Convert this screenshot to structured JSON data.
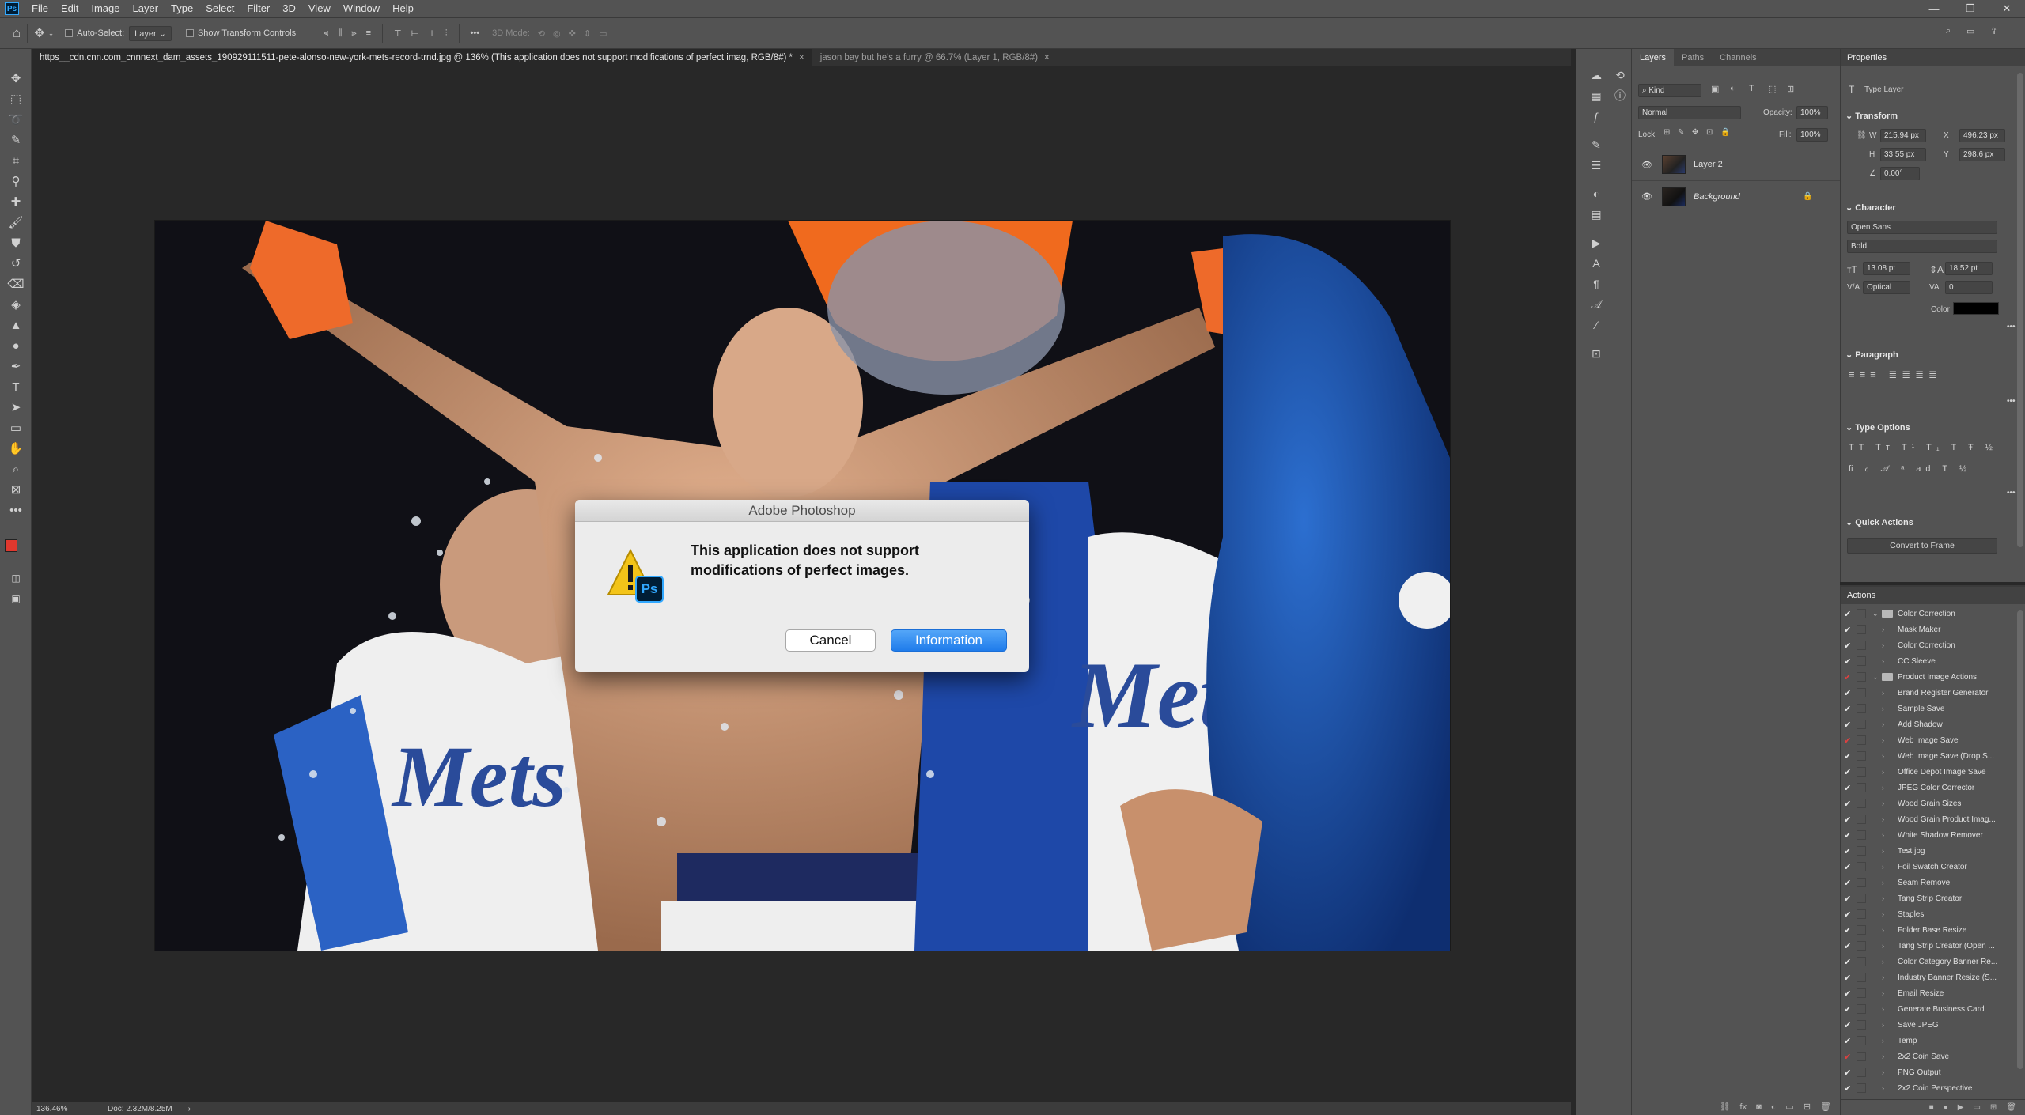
{
  "menubar": {
    "items": [
      "File",
      "Edit",
      "Image",
      "Layer",
      "Type",
      "Select",
      "Filter",
      "3D",
      "View",
      "Window",
      "Help"
    ],
    "ps_logo": "Ps",
    "window_controls": [
      "—",
      "❐",
      "✕"
    ]
  },
  "options": {
    "auto_select_label": "Auto-Select:",
    "auto_select_value": "Layer",
    "transform_label": "Show Transform Controls",
    "mode3d_label": "3D Mode:"
  },
  "tabs": [
    {
      "label": "https__cdn.cnn.com_cnnnext_dam_assets_190929111511-pete-alonso-new-york-mets-record-trnd.jpg @ 136% (This application does not support modifications of perfect imag, RGB/8#) *",
      "close": "×"
    },
    {
      "label": "jason bay but he's a furry @ 66.7% (Layer 1, RGB/8#)",
      "close": "×"
    }
  ],
  "status": {
    "zoom": "136.46%",
    "doc": "Doc: 2.32M/8.25M",
    "arrow": "›"
  },
  "dialog": {
    "title": "Adobe Photoshop",
    "message": "This application does not support modifications of perfect images.",
    "cancel": "Cancel",
    "info": "Information",
    "ps_badge": "Ps"
  },
  "layers_panel": {
    "tabs": [
      "Layers",
      "Paths",
      "Channels"
    ],
    "kind": "Kind",
    "blend": "Normal",
    "opacity_label": "Opacity:",
    "opacity": "100%",
    "lock_label": "Lock:",
    "fill_label": "Fill:",
    "fill": "100%",
    "layers": [
      {
        "name": "Layer 2"
      },
      {
        "name": "Background"
      }
    ]
  },
  "properties": {
    "title": "Properties",
    "type_label": "Type Layer",
    "transform": "Transform",
    "w": "215.94 px",
    "h": "33.55 px",
    "x": "496.23 px",
    "y": "298.6 px",
    "angle": "0.00°",
    "character": "Character",
    "font": "Open Sans",
    "style": "Bold",
    "size": "13.08 pt",
    "leading": "18.52 pt",
    "kerning": "Optical",
    "tracking": "0",
    "color_label": "Color",
    "paragraph": "Paragraph",
    "type_options": "Type Options",
    "quick_actions": "Quick Actions",
    "convert_button": "Convert to Frame"
  },
  "actions": {
    "title": "Actions",
    "items": [
      {
        "label": "Color Correction",
        "folder": true,
        "red": false
      },
      {
        "label": "Mask Maker",
        "folder": false,
        "red": false
      },
      {
        "label": "Color Correction",
        "folder": false,
        "red": false
      },
      {
        "label": "CC Sleeve",
        "folder": false,
        "red": false
      },
      {
        "label": "Product Image Actions",
        "folder": true,
        "red": true
      },
      {
        "label": "Brand Register Generator",
        "folder": false,
        "red": false
      },
      {
        "label": "Sample Save",
        "folder": false,
        "red": false
      },
      {
        "label": "Add Shadow",
        "folder": false,
        "red": false
      },
      {
        "label": "Web Image Save",
        "folder": false,
        "red": true
      },
      {
        "label": "Web Image Save (Drop S...",
        "folder": false,
        "red": false
      },
      {
        "label": "Office Depot Image Save",
        "folder": false,
        "red": false
      },
      {
        "label": "JPEG Color Corrector",
        "folder": false,
        "red": false
      },
      {
        "label": "Wood Grain Sizes",
        "folder": false,
        "red": false
      },
      {
        "label": "Wood Grain Product Imag...",
        "folder": false,
        "red": false
      },
      {
        "label": "White Shadow Remover",
        "folder": false,
        "red": false
      },
      {
        "label": "Test jpg",
        "folder": false,
        "red": false
      },
      {
        "label": "Foil Swatch Creator",
        "folder": false,
        "red": false
      },
      {
        "label": "Seam Remove",
        "folder": false,
        "red": false
      },
      {
        "label": "Tang Strip Creator",
        "folder": false,
        "red": false
      },
      {
        "label": "Staples",
        "folder": false,
        "red": false
      },
      {
        "label": "Folder Base Resize",
        "folder": false,
        "red": false
      },
      {
        "label": "Tang Strip Creator (Open ...",
        "folder": false,
        "red": false
      },
      {
        "label": "Color Category Banner Re...",
        "folder": false,
        "red": false
      },
      {
        "label": "Industry Banner Resize (S...",
        "folder": false,
        "red": false
      },
      {
        "label": "Email Resize",
        "folder": false,
        "red": false
      },
      {
        "label": "Generate Business Card",
        "folder": false,
        "red": false
      },
      {
        "label": "Save JPEG",
        "folder": false,
        "red": false
      },
      {
        "label": "Temp",
        "folder": false,
        "red": false
      },
      {
        "label": "2x2 Coin Save",
        "folder": false,
        "red": true
      },
      {
        "label": "PNG Output",
        "folder": false,
        "red": false
      },
      {
        "label": "2x2 Coin Perspective",
        "folder": false,
        "red": false
      }
    ]
  }
}
